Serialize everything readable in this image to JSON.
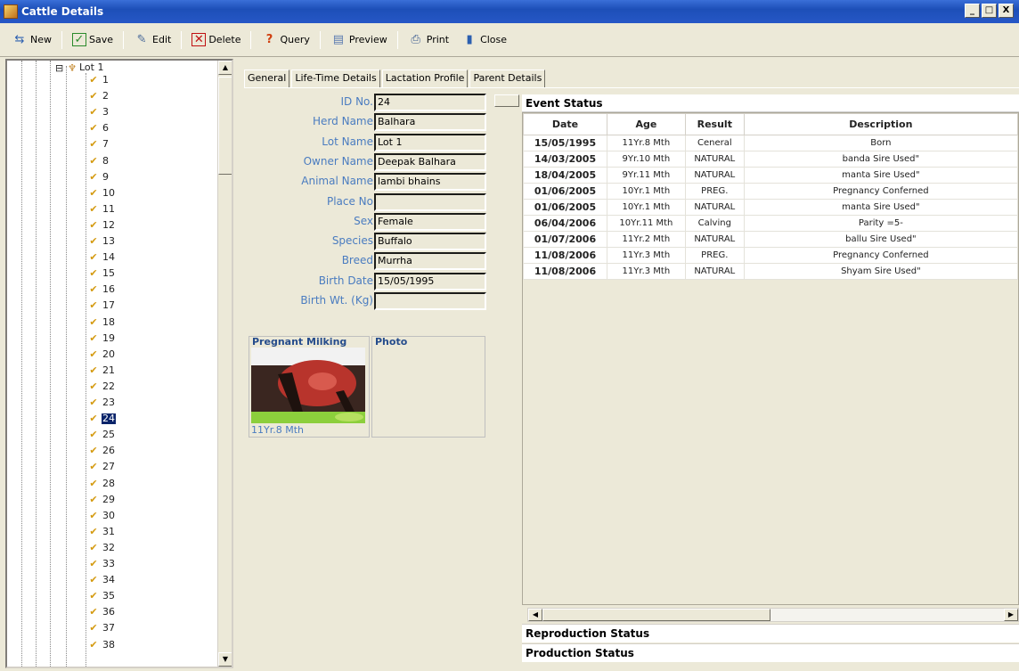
{
  "window": {
    "title": "Cattle Details",
    "min_label": "_",
    "max_label": "□",
    "close_label": "X"
  },
  "toolbar": {
    "new": "New",
    "save": "Save",
    "edit": "Edit",
    "delete": "Delete",
    "query": "Query",
    "preview": "Preview",
    "print": "Print",
    "close": "Close"
  },
  "tree": {
    "root": "Lot 1",
    "expander": "⊟",
    "items": [
      "1",
      "2",
      "3",
      "6",
      "7",
      "8",
      "9",
      "10",
      "11",
      "12",
      "13",
      "14",
      "15",
      "16",
      "17",
      "18",
      "19",
      "20",
      "21",
      "22",
      "23",
      "24",
      "25",
      "26",
      "27",
      "28",
      "29",
      "30",
      "31",
      "32",
      "33",
      "34",
      "35",
      "36",
      "37",
      "38"
    ],
    "selected": "24",
    "scroll_up": "▲",
    "scroll_down": "▼"
  },
  "tabs": [
    "General",
    "Life-Time Details",
    "Lactation Profile",
    "Parent Details"
  ],
  "form": {
    "fields": [
      {
        "label": "ID No.",
        "value": "24"
      },
      {
        "label": "Herd Name",
        "value": "Balhara"
      },
      {
        "label": "Lot Name",
        "value": "Lot 1"
      },
      {
        "label": "Owner Name",
        "value": "Deepak Balhara"
      },
      {
        "label": "Animal Name",
        "value": "lambi bhains"
      },
      {
        "label": "Place No",
        "value": ""
      },
      {
        "label": "Sex",
        "value": "Female"
      },
      {
        "label": "Species",
        "value": "Buffalo"
      },
      {
        "label": "Breed",
        "value": "Murrha"
      },
      {
        "label": "Birth Date",
        "value": "15/05/1995"
      },
      {
        "label": "Birth Wt. (Kg)",
        "value": ""
      }
    ]
  },
  "photos": {
    "pregnant_title": "Pregnant Milking",
    "pregnant_caption": "11Yr.8 Mth",
    "photo_title": "Photo"
  },
  "event_status": {
    "title": "Event Status",
    "columns": [
      "Date",
      "Age",
      "Result",
      "Description"
    ],
    "rows": [
      [
        "15/05/1995",
        "11Yr.8 Mth",
        "Ceneral",
        "Born"
      ],
      [
        "14/03/2005",
        "9Yr.10 Mth",
        "NATURAL",
        "banda Sire Used\""
      ],
      [
        "18/04/2005",
        "9Yr.11 Mth",
        "NATURAL",
        "manta Sire Used\""
      ],
      [
        "01/06/2005",
        "10Yr.1 Mth",
        "PREG.",
        "Pregnancy Conferned"
      ],
      [
        "01/06/2005",
        "10Yr.1 Mth",
        "NATURAL",
        "manta Sire Used\""
      ],
      [
        "06/04/2006",
        "10Yr.11 Mth",
        "Calving",
        "Parity =5-"
      ],
      [
        "01/07/2006",
        "11Yr.2 Mth",
        "NATURAL",
        "ballu Sire Used\""
      ],
      [
        "11/08/2006",
        "11Yr.3 Mth",
        "PREG.",
        "Pregnancy Conferned"
      ],
      [
        "11/08/2006",
        "11Yr.3 Mth",
        "NATURAL",
        "Shyam Sire Used\""
      ]
    ],
    "scroll_left": "◀",
    "scroll_right": "▶"
  },
  "sections": {
    "reproduction": "Reproduction Status",
    "production": "Production Status"
  }
}
